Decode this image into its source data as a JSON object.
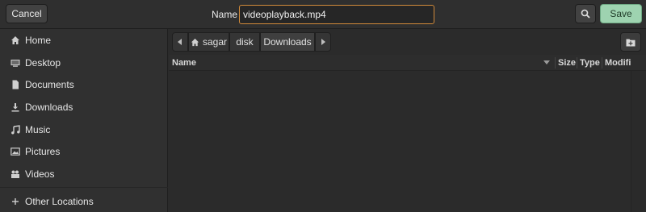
{
  "header": {
    "cancel_label": "Cancel",
    "name_label": "Name",
    "filename_value": "videoplayback.mp4",
    "search_icon": "search-icon",
    "save_label": "Save"
  },
  "sidebar": {
    "items": [
      {
        "label": "Home",
        "icon": "home-icon"
      },
      {
        "label": "Desktop",
        "icon": "desktop-icon"
      },
      {
        "label": "Documents",
        "icon": "document-icon"
      },
      {
        "label": "Downloads",
        "icon": "download-icon"
      },
      {
        "label": "Music",
        "icon": "music-icon"
      },
      {
        "label": "Pictures",
        "icon": "picture-icon"
      },
      {
        "label": "Videos",
        "icon": "video-icon"
      },
      {
        "label": "Other Locations",
        "icon": "plus-icon"
      }
    ]
  },
  "pathbar": {
    "crumbs": [
      "sagar",
      "disk",
      "Downloads"
    ],
    "active_crumb": "Downloads"
  },
  "list": {
    "columns": [
      "Name",
      "Size",
      "Type",
      "Modifie"
    ]
  },
  "colors": {
    "accent": "#d18a3a",
    "save": "#9ed3b0",
    "background": "#2b2b2b"
  }
}
